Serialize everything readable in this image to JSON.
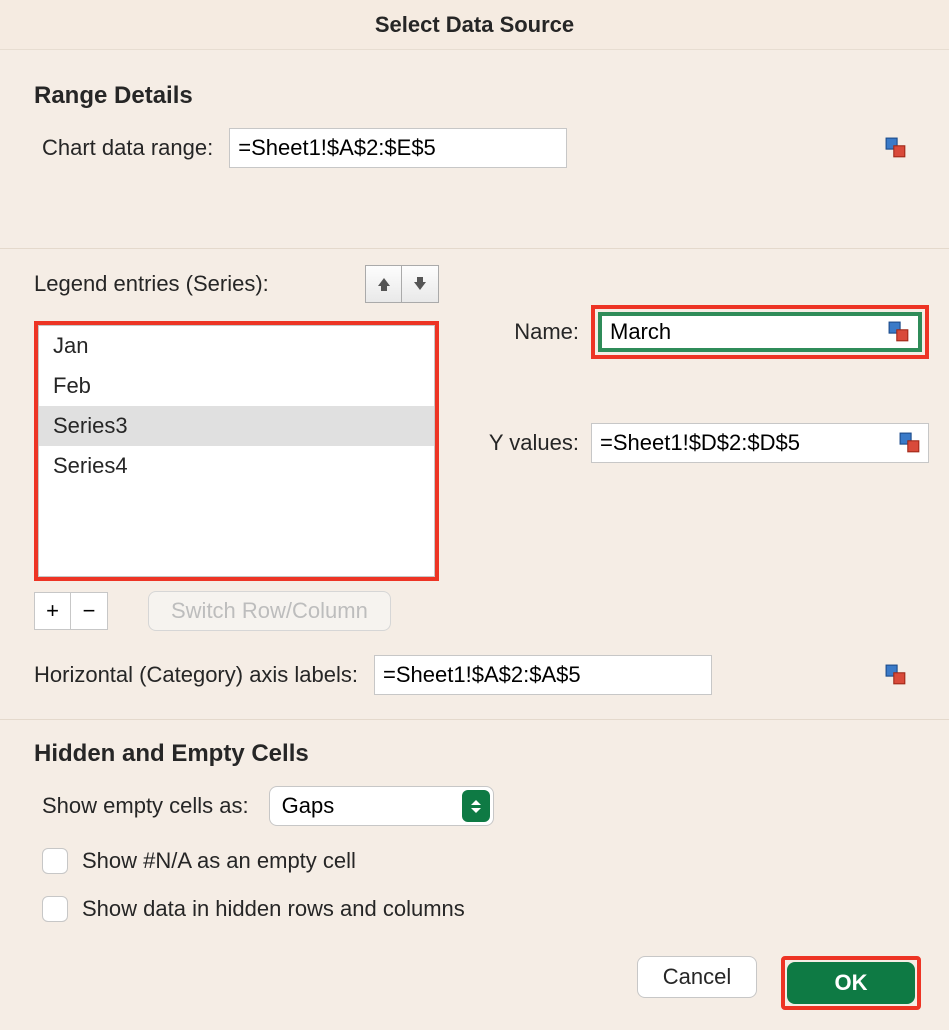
{
  "title": "Select Data Source",
  "range_details": {
    "section_title": "Range Details",
    "chart_data_range_label": "Chart data range:",
    "chart_data_range_value": "=Sheet1!$A$2:$E$5"
  },
  "legend": {
    "label": "Legend entries (Series):",
    "items": [
      "Jan",
      "Feb",
      "Series3",
      "Series4"
    ],
    "selected_index": 2,
    "add_label": "+",
    "remove_label": "−",
    "switch_label": "Switch Row/Column"
  },
  "series_detail": {
    "name_label": "Name:",
    "name_value": "March",
    "yvalues_label": "Y values:",
    "yvalues_value": "=Sheet1!$D$2:$D$5"
  },
  "haxis": {
    "label": "Horizontal (Category) axis labels:",
    "value": "=Sheet1!$A$2:$A$5"
  },
  "hidden": {
    "section_title": "Hidden and Empty Cells",
    "show_empty_label": "Show empty cells as:",
    "show_empty_value": "Gaps",
    "na_label": "Show #N/A as an empty cell",
    "hidden_rows_label": "Show data in hidden rows and columns"
  },
  "footer": {
    "cancel": "Cancel",
    "ok": "OK"
  }
}
